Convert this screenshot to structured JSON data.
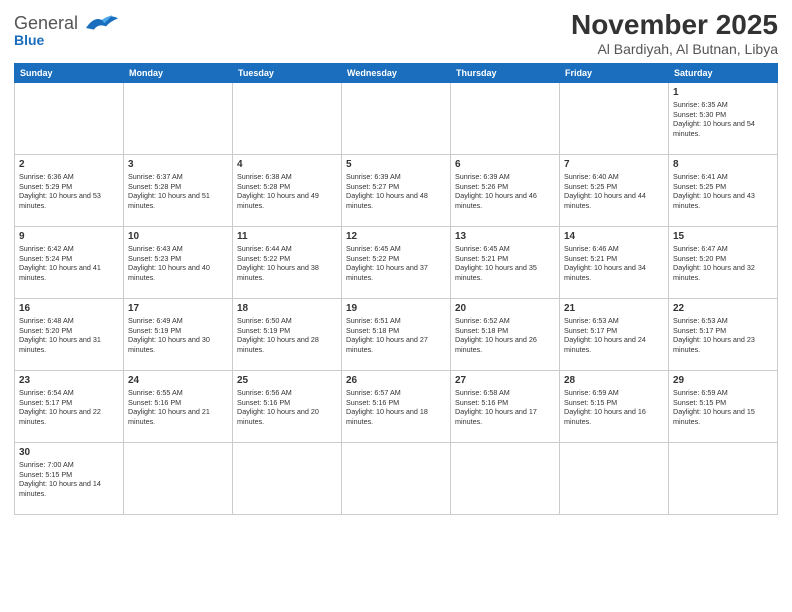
{
  "header": {
    "logo_general": "General",
    "logo_blue": "Blue",
    "month": "November 2025",
    "location": "Al Bardiyah, Al Butnan, Libya"
  },
  "weekdays": [
    "Sunday",
    "Monday",
    "Tuesday",
    "Wednesday",
    "Thursday",
    "Friday",
    "Saturday"
  ],
  "weeks": [
    [
      {
        "day": "",
        "sunrise": "",
        "sunset": "",
        "daylight": ""
      },
      {
        "day": "",
        "sunrise": "",
        "sunset": "",
        "daylight": ""
      },
      {
        "day": "",
        "sunrise": "",
        "sunset": "",
        "daylight": ""
      },
      {
        "day": "",
        "sunrise": "",
        "sunset": "",
        "daylight": ""
      },
      {
        "day": "",
        "sunrise": "",
        "sunset": "",
        "daylight": ""
      },
      {
        "day": "",
        "sunrise": "",
        "sunset": "",
        "daylight": ""
      },
      {
        "day": "1",
        "sunrise": "Sunrise: 6:35 AM",
        "sunset": "Sunset: 5:30 PM",
        "daylight": "Daylight: 10 hours and 54 minutes."
      }
    ],
    [
      {
        "day": "2",
        "sunrise": "Sunrise: 6:36 AM",
        "sunset": "Sunset: 5:29 PM",
        "daylight": "Daylight: 10 hours and 53 minutes."
      },
      {
        "day": "3",
        "sunrise": "Sunrise: 6:37 AM",
        "sunset": "Sunset: 5:28 PM",
        "daylight": "Daylight: 10 hours and 51 minutes."
      },
      {
        "day": "4",
        "sunrise": "Sunrise: 6:38 AM",
        "sunset": "Sunset: 5:28 PM",
        "daylight": "Daylight: 10 hours and 49 minutes."
      },
      {
        "day": "5",
        "sunrise": "Sunrise: 6:39 AM",
        "sunset": "Sunset: 5:27 PM",
        "daylight": "Daylight: 10 hours and 48 minutes."
      },
      {
        "day": "6",
        "sunrise": "Sunrise: 6:39 AM",
        "sunset": "Sunset: 5:26 PM",
        "daylight": "Daylight: 10 hours and 46 minutes."
      },
      {
        "day": "7",
        "sunrise": "Sunrise: 6:40 AM",
        "sunset": "Sunset: 5:25 PM",
        "daylight": "Daylight: 10 hours and 44 minutes."
      },
      {
        "day": "8",
        "sunrise": "Sunrise: 6:41 AM",
        "sunset": "Sunset: 5:25 PM",
        "daylight": "Daylight: 10 hours and 43 minutes."
      }
    ],
    [
      {
        "day": "9",
        "sunrise": "Sunrise: 6:42 AM",
        "sunset": "Sunset: 5:24 PM",
        "daylight": "Daylight: 10 hours and 41 minutes."
      },
      {
        "day": "10",
        "sunrise": "Sunrise: 6:43 AM",
        "sunset": "Sunset: 5:23 PM",
        "daylight": "Daylight: 10 hours and 40 minutes."
      },
      {
        "day": "11",
        "sunrise": "Sunrise: 6:44 AM",
        "sunset": "Sunset: 5:22 PM",
        "daylight": "Daylight: 10 hours and 38 minutes."
      },
      {
        "day": "12",
        "sunrise": "Sunrise: 6:45 AM",
        "sunset": "Sunset: 5:22 PM",
        "daylight": "Daylight: 10 hours and 37 minutes."
      },
      {
        "day": "13",
        "sunrise": "Sunrise: 6:45 AM",
        "sunset": "Sunset: 5:21 PM",
        "daylight": "Daylight: 10 hours and 35 minutes."
      },
      {
        "day": "14",
        "sunrise": "Sunrise: 6:46 AM",
        "sunset": "Sunset: 5:21 PM",
        "daylight": "Daylight: 10 hours and 34 minutes."
      },
      {
        "day": "15",
        "sunrise": "Sunrise: 6:47 AM",
        "sunset": "Sunset: 5:20 PM",
        "daylight": "Daylight: 10 hours and 32 minutes."
      }
    ],
    [
      {
        "day": "16",
        "sunrise": "Sunrise: 6:48 AM",
        "sunset": "Sunset: 5:20 PM",
        "daylight": "Daylight: 10 hours and 31 minutes."
      },
      {
        "day": "17",
        "sunrise": "Sunrise: 6:49 AM",
        "sunset": "Sunset: 5:19 PM",
        "daylight": "Daylight: 10 hours and 30 minutes."
      },
      {
        "day": "18",
        "sunrise": "Sunrise: 6:50 AM",
        "sunset": "Sunset: 5:19 PM",
        "daylight": "Daylight: 10 hours and 28 minutes."
      },
      {
        "day": "19",
        "sunrise": "Sunrise: 6:51 AM",
        "sunset": "Sunset: 5:18 PM",
        "daylight": "Daylight: 10 hours and 27 minutes."
      },
      {
        "day": "20",
        "sunrise": "Sunrise: 6:52 AM",
        "sunset": "Sunset: 5:18 PM",
        "daylight": "Daylight: 10 hours and 26 minutes."
      },
      {
        "day": "21",
        "sunrise": "Sunrise: 6:53 AM",
        "sunset": "Sunset: 5:17 PM",
        "daylight": "Daylight: 10 hours and 24 minutes."
      },
      {
        "day": "22",
        "sunrise": "Sunrise: 6:53 AM",
        "sunset": "Sunset: 5:17 PM",
        "daylight": "Daylight: 10 hours and 23 minutes."
      }
    ],
    [
      {
        "day": "23",
        "sunrise": "Sunrise: 6:54 AM",
        "sunset": "Sunset: 5:17 PM",
        "daylight": "Daylight: 10 hours and 22 minutes."
      },
      {
        "day": "24",
        "sunrise": "Sunrise: 6:55 AM",
        "sunset": "Sunset: 5:16 PM",
        "daylight": "Daylight: 10 hours and 21 minutes."
      },
      {
        "day": "25",
        "sunrise": "Sunrise: 6:56 AM",
        "sunset": "Sunset: 5:16 PM",
        "daylight": "Daylight: 10 hours and 20 minutes."
      },
      {
        "day": "26",
        "sunrise": "Sunrise: 6:57 AM",
        "sunset": "Sunset: 5:16 PM",
        "daylight": "Daylight: 10 hours and 18 minutes."
      },
      {
        "day": "27",
        "sunrise": "Sunrise: 6:58 AM",
        "sunset": "Sunset: 5:16 PM",
        "daylight": "Daylight: 10 hours and 17 minutes."
      },
      {
        "day": "28",
        "sunrise": "Sunrise: 6:59 AM",
        "sunset": "Sunset: 5:15 PM",
        "daylight": "Daylight: 10 hours and 16 minutes."
      },
      {
        "day": "29",
        "sunrise": "Sunrise: 6:59 AM",
        "sunset": "Sunset: 5:15 PM",
        "daylight": "Daylight: 10 hours and 15 minutes."
      }
    ],
    [
      {
        "day": "30",
        "sunrise": "Sunrise: 7:00 AM",
        "sunset": "Sunset: 5:15 PM",
        "daylight": "Daylight: 10 hours and 14 minutes."
      },
      {
        "day": "",
        "sunrise": "",
        "sunset": "",
        "daylight": ""
      },
      {
        "day": "",
        "sunrise": "",
        "sunset": "",
        "daylight": ""
      },
      {
        "day": "",
        "sunrise": "",
        "sunset": "",
        "daylight": ""
      },
      {
        "day": "",
        "sunrise": "",
        "sunset": "",
        "daylight": ""
      },
      {
        "day": "",
        "sunrise": "",
        "sunset": "",
        "daylight": ""
      },
      {
        "day": "",
        "sunrise": "",
        "sunset": "",
        "daylight": ""
      }
    ]
  ]
}
